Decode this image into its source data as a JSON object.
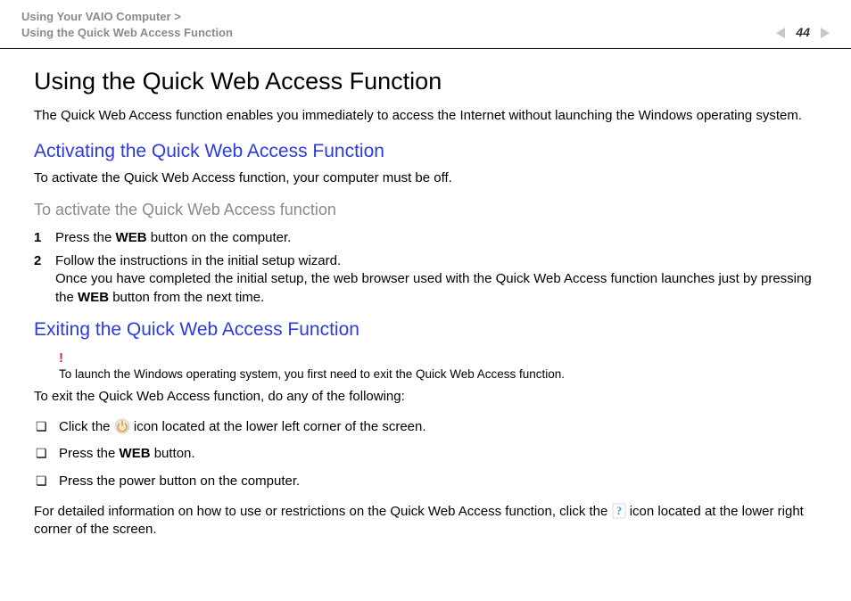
{
  "header": {
    "breadcrumb_line1": "Using Your VAIO Computer",
    "breadcrumb_sep": ">",
    "breadcrumb_line2": "Using the Quick Web Access Function",
    "page_number": "44"
  },
  "page": {
    "title": "Using the Quick Web Access Function",
    "intro": "The Quick Web Access function enables you immediately to access the Internet without launching the Windows operating system.",
    "section_activate": {
      "heading": "Activating the Quick Web Access Function",
      "intro": "To activate the Quick Web Access function, your computer must be off.",
      "procedure_heading": "To activate the Quick Web Access function",
      "steps": {
        "s1_pre": "Press the ",
        "s1_bold": "WEB",
        "s1_post": " button on the computer.",
        "s2_line1": "Follow the instructions in the initial setup wizard.",
        "s2_line2_pre": "Once you have completed the initial setup, the web browser used with the Quick Web Access function launches just by pressing the ",
        "s2_line2_bold": "WEB",
        "s2_line2_post": " button from the next time."
      }
    },
    "section_exit": {
      "heading": "Exiting the Quick Web Access Function",
      "bang_mark": "!",
      "bang_text": "To launch the Windows operating system, you first need to exit the Quick Web Access function.",
      "intro": "To exit the Quick Web Access function, do any of the following:",
      "bullets": {
        "b1_pre": "Click the ",
        "b1_post": " icon located at the lower left corner of the screen.",
        "b2_pre": "Press the ",
        "b2_bold": "WEB",
        "b2_post": " button.",
        "b3": "Press the power button on the computer."
      },
      "trailing_pre": "For detailed information on how to use or restrictions on the Quick Web Access function, click the ",
      "trailing_post": " icon located at the lower right corner of the screen."
    }
  }
}
